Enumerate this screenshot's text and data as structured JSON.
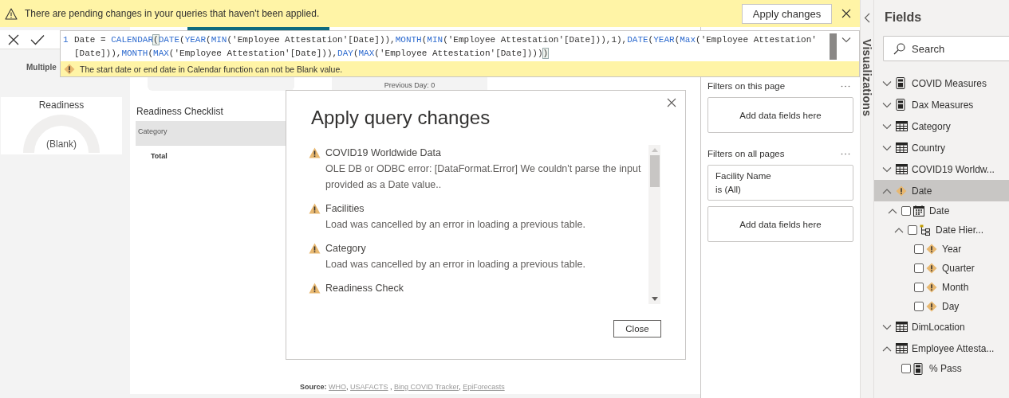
{
  "banner": {
    "message": "There are pending changes in your queries that haven't been applied.",
    "apply_button": "Apply changes"
  },
  "formula_bar": {
    "line_number": "1",
    "lines": [
      [
        {
          "text": "Date = ",
          "kind": "plain"
        },
        {
          "text": "CALENDAR",
          "kind": "function"
        },
        {
          "text": "(",
          "kind": "match"
        },
        {
          "text": "DATE",
          "kind": "function"
        },
        {
          "text": "(",
          "kind": "plain"
        },
        {
          "text": "YEAR",
          "kind": "function"
        },
        {
          "text": "(",
          "kind": "plain"
        },
        {
          "text": "MIN",
          "kind": "function"
        },
        {
          "text": "('Employee Attestation'[Date])),",
          "kind": "plain"
        },
        {
          "text": "MONTH",
          "kind": "function"
        },
        {
          "text": "(",
          "kind": "plain"
        },
        {
          "text": "MIN",
          "kind": "function"
        },
        {
          "text": "('Employee Attestation'[Date])),1),",
          "kind": "plain"
        },
        {
          "text": "DATE",
          "kind": "function"
        },
        {
          "text": "(",
          "kind": "plain"
        },
        {
          "text": "YEAR",
          "kind": "function"
        },
        {
          "text": "(",
          "kind": "plain"
        },
        {
          "text": "Max",
          "kind": "function"
        },
        {
          "text": "('Employee Attestation'",
          "kind": "plain"
        }
      ],
      [
        {
          "text": "[Date])),",
          "kind": "plain"
        },
        {
          "text": "MONTH",
          "kind": "function"
        },
        {
          "text": "(",
          "kind": "plain"
        },
        {
          "text": "MAX",
          "kind": "function"
        },
        {
          "text": "('Employee Attestation'[Date])),",
          "kind": "plain"
        },
        {
          "text": "DAY",
          "kind": "function"
        },
        {
          "text": "(",
          "kind": "plain"
        },
        {
          "text": "MAX",
          "kind": "function"
        },
        {
          "text": "('Employee Attestation'[Date])))",
          "kind": "plain"
        },
        {
          "text": ")",
          "kind": "match"
        }
      ]
    ],
    "error": "The start date or end date in Calendar function can not be Blank value."
  },
  "canvas": {
    "slicer_label": "Multiple",
    "card_caption": "Previous Day: 0",
    "gauge": {
      "title": "Readiness",
      "value": "(Blank)"
    },
    "table": {
      "title": "Readiness Checklist",
      "columns": [
        "Category"
      ],
      "total_label": "Total"
    },
    "source": {
      "label": "Source:",
      "parts": [
        {
          "text": "WHO",
          "kind": "link"
        },
        {
          "text": ", ",
          "kind": "text"
        },
        {
          "text": "USAFACTS",
          "kind": "link"
        },
        {
          "text": " , ",
          "kind": "text"
        },
        {
          "text": "Bing COVID Tracker",
          "kind": "link"
        },
        {
          "text": ", ",
          "kind": "text"
        },
        {
          "text": "EpiForecasts",
          "kind": "link"
        }
      ]
    }
  },
  "dialog": {
    "title": "Apply query changes",
    "items": [
      {
        "title": "COVID19 Worldwide Data",
        "message": "OLE DB or ODBC error: [DataFormat.Error] We couldn't parse the input provided as a Date value.."
      },
      {
        "title": "Facilities",
        "message": "Load was cancelled by an error in loading a previous table."
      },
      {
        "title": "Category",
        "message": "Load was cancelled by an error in loading a previous table."
      },
      {
        "title": "Readiness Check"
      }
    ],
    "close_button": "Close"
  },
  "filters": {
    "sections": [
      {
        "title": "Filters on this page",
        "cards": [
          {
            "kind": "drop",
            "text": "Add data fields here"
          }
        ]
      },
      {
        "title": "Filters on all pages",
        "cards": [
          {
            "kind": "filter",
            "name": "Facility Name",
            "condition": "is (All)"
          },
          {
            "kind": "drop",
            "text": "Add data fields here"
          }
        ]
      }
    ]
  },
  "visualizations": {
    "title": "Visualizations"
  },
  "fields": {
    "title": "Fields",
    "search": {
      "placeholder": "Search"
    },
    "items": [
      {
        "label": "COVID Measures",
        "kind": "measures",
        "expanded": false,
        "selected": false
      },
      {
        "label": "Dax Measures",
        "kind": "measures",
        "expanded": false,
        "selected": false
      },
      {
        "label": "Category",
        "kind": "table",
        "expanded": false,
        "selected": false
      },
      {
        "label": "Country",
        "kind": "table",
        "expanded": false,
        "selected": false
      },
      {
        "label": "COVID19 Worldw...",
        "kind": "table",
        "expanded": false,
        "selected": false
      },
      {
        "label": "Date",
        "kind": "warning",
        "expanded": true,
        "selected": true,
        "children": [
          {
            "label": "Date",
            "kind": "calendar",
            "checked": false,
            "expanded": true,
            "children": [
              {
                "label": "Date Hier...",
                "kind": "hierarchy",
                "checked": false,
                "expanded": true,
                "children": [
                  {
                    "label": "Year",
                    "kind": "warning",
                    "checked": false
                  },
                  {
                    "label": "Quarter",
                    "kind": "warning",
                    "checked": false
                  },
                  {
                    "label": "Month",
                    "kind": "warning",
                    "checked": false
                  },
                  {
                    "label": "Day",
                    "kind": "warning",
                    "checked": false
                  }
                ]
              }
            ]
          }
        ]
      },
      {
        "label": "DimLocation",
        "kind": "table",
        "expanded": false,
        "selected": false
      },
      {
        "label": "Employee Attesta...",
        "kind": "table",
        "expanded": true,
        "selected": false,
        "children": [
          {
            "label": "% Pass",
            "kind": "measure",
            "checked": false
          }
        ]
      }
    ]
  }
}
